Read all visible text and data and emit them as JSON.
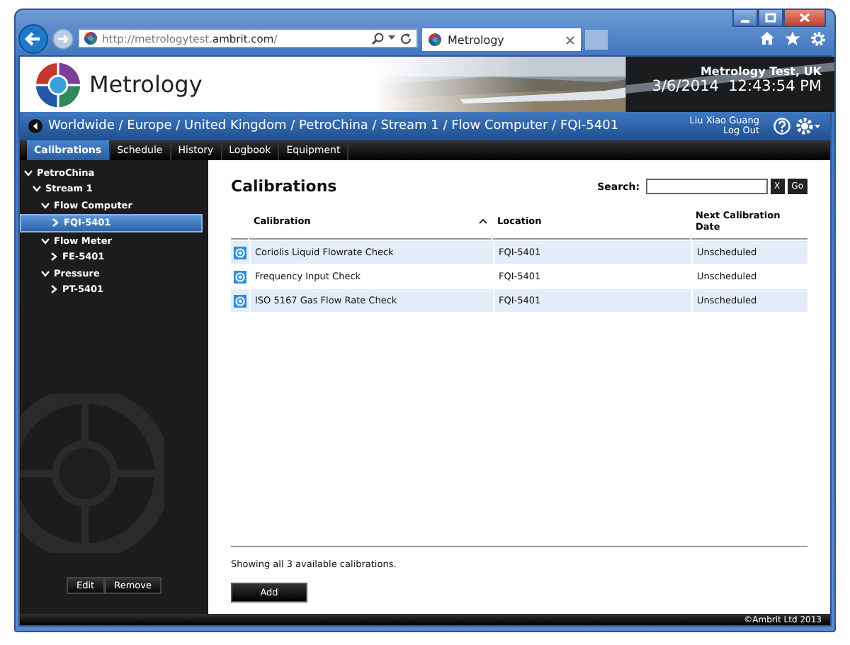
{
  "browser": {
    "address": "http://metrologytest.**ambrit.com**/",
    "tab_title": "Metrology"
  },
  "header": {
    "logo_text": "Metrology",
    "site": "Metrology Test, UK",
    "datetime": "3/6/2014  12:43:54 PM"
  },
  "breadcrumb": "Worldwide / Europe / United Kingdom / PetroChina / Stream 1 / Flow Computer / FQI-5401",
  "user": {
    "name": "Liu Xiao Guang",
    "logout": "Log Out"
  },
  "tabs": [
    {
      "label": "Calibrations",
      "selected": true
    },
    {
      "label": "Schedule",
      "selected": false
    },
    {
      "label": "History",
      "selected": false
    },
    {
      "label": "Logbook",
      "selected": false
    },
    {
      "label": "Equipment",
      "selected": false
    }
  ],
  "tree": [
    {
      "label": "PetroChina",
      "expanded": true,
      "selected": false,
      "children": [
        {
          "label": "Stream 1",
          "expanded": true,
          "selected": false,
          "children": [
            {
              "label": "Flow Computer",
              "expanded": true,
              "selected": false,
              "children": [
                {
                  "label": "FQI-5401",
                  "expanded": false,
                  "selected": true
                }
              ]
            },
            {
              "label": "Flow Meter",
              "expanded": true,
              "selected": false,
              "children": [
                {
                  "label": "FE-5401",
                  "expanded": false,
                  "selected": false
                }
              ]
            },
            {
              "label": "Pressure",
              "expanded": true,
              "selected": false,
              "children": [
                {
                  "label": "PT-5401",
                  "expanded": false,
                  "selected": false
                }
              ]
            }
          ]
        }
      ]
    }
  ],
  "sidebar_buttons": [
    "Edit",
    "Remove"
  ],
  "page_title": "Calibrations",
  "search": {
    "label": "Search:",
    "buttons": [
      "X",
      "Go"
    ]
  },
  "table": {
    "columns": [
      {
        "label": "Calibration",
        "sorted": true
      },
      {
        "label": "Location",
        "sorted": false
      },
      {
        "label": "Next Calibration Date",
        "sorted": false
      }
    ],
    "rows": [
      [
        "Coriolis Liquid Flowrate Check",
        "FQI-5401",
        "Unscheduled"
      ],
      [
        "Frequency Input Check",
        "FQI-5401",
        "Unscheduled"
      ],
      [
        "ISO 5167 Gas Flow Rate Check",
        "FQI-5401",
        "Unscheduled"
      ]
    ]
  },
  "status": "Showing all 3 available calibrations.",
  "add_button": "Add",
  "footer": "©Ambrit Ltd 2013"
}
